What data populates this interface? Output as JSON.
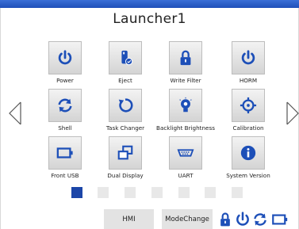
{
  "title": "Launcher1",
  "tiles": [
    {
      "label": "Power"
    },
    {
      "label": "Eject"
    },
    {
      "label": "Write Filter"
    },
    {
      "label": "HORM"
    },
    {
      "label": "Shell"
    },
    {
      "label": "Task Changer"
    },
    {
      "label": "Backlight Brightness"
    },
    {
      "label": "Calibration"
    },
    {
      "label": "Front USB"
    },
    {
      "label": "Dual Display"
    },
    {
      "label": "UART"
    },
    {
      "label": "System Version"
    }
  ],
  "pager": {
    "active_index": 0,
    "count": 7
  },
  "buttons": {
    "hmi": "HMI",
    "mode_change": "ModeChange"
  },
  "colors": {
    "accent": "#1c46a8",
    "topbar": "#2a5cc8"
  },
  "icons": {
    "status": [
      "lock-icon",
      "power-icon",
      "refresh-icon",
      "battery-icon"
    ]
  }
}
